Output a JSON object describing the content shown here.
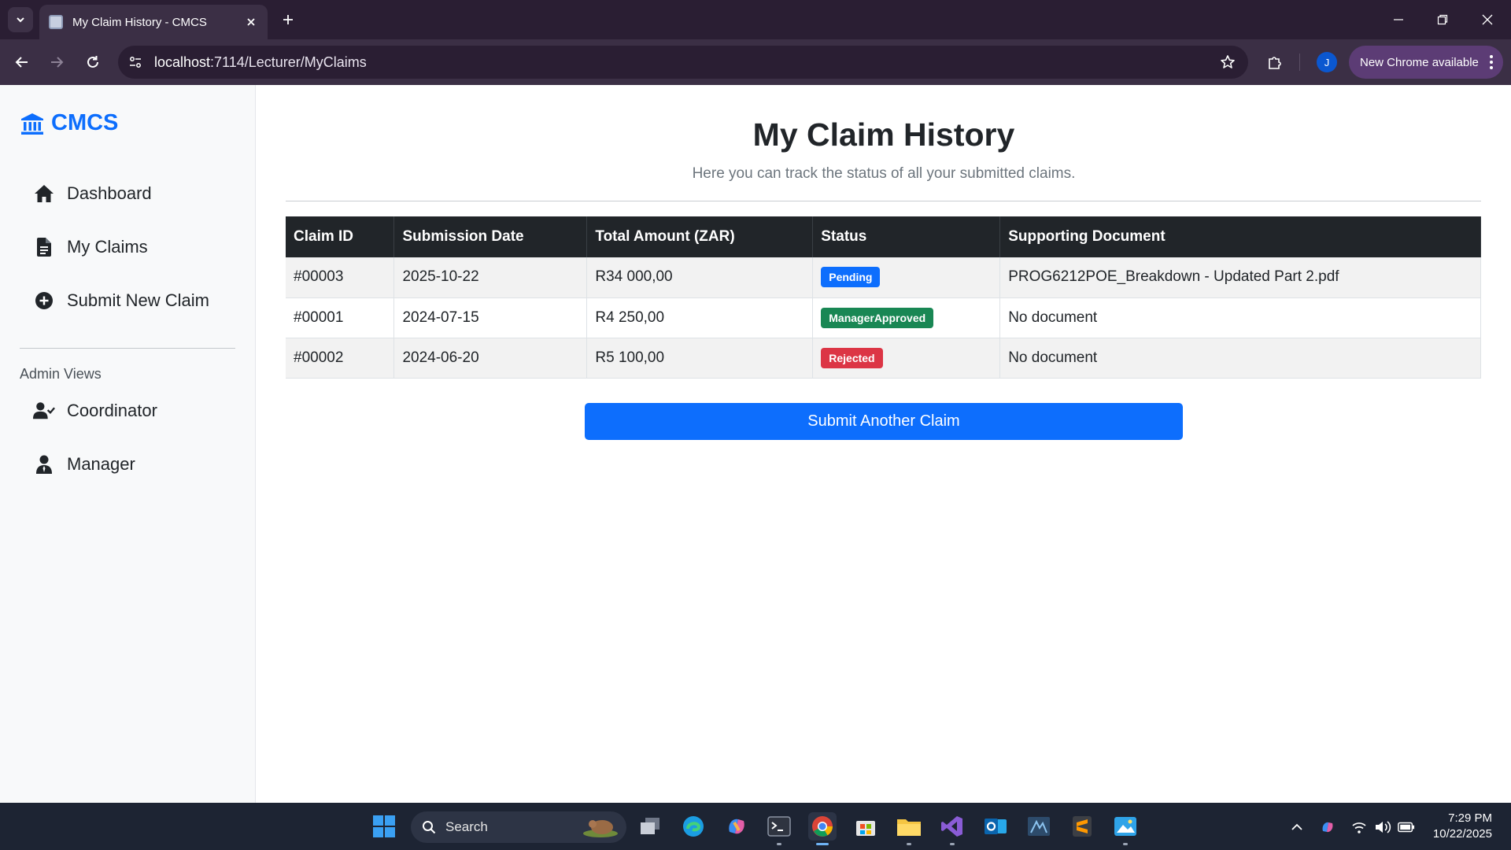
{
  "browser": {
    "tab_title": "My Claim History - CMCS",
    "url_host": "localhost",
    "url_rest": ":7114/Lecturer/MyClaims",
    "profile_initial": "J",
    "update_label": "New Chrome available"
  },
  "sidebar": {
    "brand": "CMCS",
    "items": [
      {
        "label": "Dashboard",
        "icon": "home-icon"
      },
      {
        "label": "My Claims",
        "icon": "document-icon"
      },
      {
        "label": "Submit New Claim",
        "icon": "plus-circle-icon"
      }
    ],
    "admin_heading": "Admin Views",
    "admin_items": [
      {
        "label": "Coordinator",
        "icon": "user-check-icon"
      },
      {
        "label": "Manager",
        "icon": "user-tie-icon"
      }
    ]
  },
  "main": {
    "title": "My Claim History",
    "lead": "Here you can track the status of all your submitted claims.",
    "table": {
      "headers": [
        "Claim ID",
        "Submission Date",
        "Total Amount (ZAR)",
        "Status",
        "Supporting Document"
      ],
      "rows": [
        {
          "id": "#00003",
          "date": "2025-10-22",
          "amount": "R34 000,00",
          "status": "Pending",
          "status_color": "#0d6efd",
          "document": "PROG6212POE_Breakdown - Updated Part 2.pdf"
        },
        {
          "id": "#00001",
          "date": "2024-07-15",
          "amount": "R4 250,00",
          "status": "ManagerApproved",
          "status_color": "#198754",
          "document": "No document"
        },
        {
          "id": "#00002",
          "date": "2024-06-20",
          "amount": "R5 100,00",
          "status": "Rejected",
          "status_color": "#dc3545",
          "document": "No document"
        }
      ]
    },
    "submit_label": "Submit Another Claim"
  },
  "taskbar": {
    "search_label": "Search",
    "time": "7:29 PM",
    "date": "10/22/2025"
  },
  "colors": {
    "brand": "#0d6efd",
    "table_header": "#212529",
    "chrome_frame": "#2a1e33",
    "chrome_toolbar": "#3b2f45"
  }
}
